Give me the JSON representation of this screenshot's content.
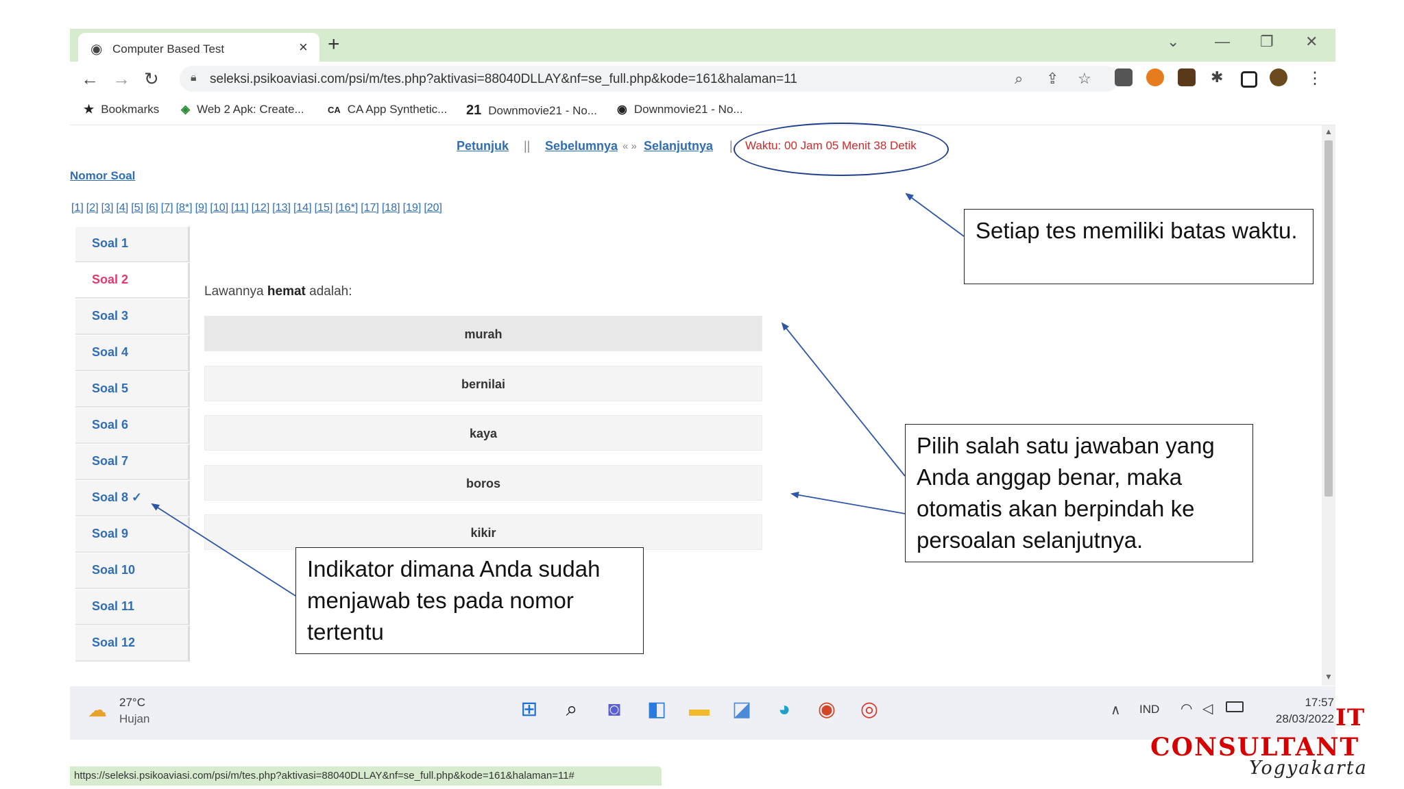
{
  "browser": {
    "tab_title": "Computer Based Test",
    "tab_close": "×",
    "new_tab": "+",
    "window_controls": {
      "tab_search": "⌄",
      "minimize": "—",
      "restore": "❐",
      "close": "✕"
    },
    "url": "seleksi.psikoaviasi.com/psi/m/tes.php?aktivasi=88040DLLAY&nf=se_full.php&kode=161&halaman=11",
    "bookmarks": [
      {
        "icon": "star-icon",
        "label": "Bookmarks"
      },
      {
        "icon": "web2apk-icon",
        "label": "Web 2 Apk: Create..."
      },
      {
        "icon": "ca-icon",
        "label": "CA App Synthetic..."
      },
      {
        "icon": "21-icon",
        "label": "Downmovie21 - No..."
      },
      {
        "icon": "globe-icon",
        "label": "Downmovie21 - No..."
      }
    ],
    "status_url": "https://seleksi.psikoaviasi.com/psi/m/tes.php?aktivasi=88040DLLAY&nf=se_full.php&kode=161&halaman=11#"
  },
  "test": {
    "nav": {
      "petunjuk": "Petunjuk",
      "sep": "||",
      "sebelumnya": "Sebelumnya",
      "arrows": "« »",
      "selanjutnya": "Selanjutnya",
      "sep2": "|",
      "timer": "Waktu: 00 Jam 05 Menit 38 Detik"
    },
    "nomor_soal_label": "Nomor Soal",
    "numbers": [
      "[1]",
      "[2]",
      "[3]",
      "[4]",
      "[5]",
      "[6]",
      "[7]",
      "[8*]",
      "[9]",
      "[10]",
      "[11]",
      "[12]",
      "[13]",
      "[14]",
      "[15]",
      "[16*]",
      "[17]",
      "[18]",
      "[19]",
      "[20]"
    ],
    "sidebar": [
      {
        "label": "Soal 1"
      },
      {
        "label": "Soal 2",
        "active": true
      },
      {
        "label": "Soal 3"
      },
      {
        "label": "Soal 4"
      },
      {
        "label": "Soal 5"
      },
      {
        "label": "Soal 6"
      },
      {
        "label": "Soal 7"
      },
      {
        "label": "Soal 8 ✓"
      },
      {
        "label": "Soal 9"
      },
      {
        "label": "Soal 10"
      },
      {
        "label": "Soal 11"
      },
      {
        "label": "Soal 12"
      }
    ],
    "question_pre": "Lawannya",
    "question_bold": "hemat",
    "question_post": "adalah:",
    "options": [
      "murah",
      "bernilai",
      "kaya",
      "boros",
      "kikir"
    ]
  },
  "taskbar": {
    "temp": "27°C",
    "condition": "Hujan",
    "lang": "IND",
    "time": "17:57",
    "date": "28/03/2022"
  },
  "annotations": {
    "time_limit": "Setiap tes memiliki batas waktu.",
    "answer_hint": "Pilih salah satu jawaban yang Anda anggap benar, maka otomatis akan berpindah ke persoalan selanjutnya.",
    "indicator_hint": "Indikator dimana Anda sudah menjawab tes pada nomor tertentu",
    "arrow_color": "#2d55a8"
  },
  "logo": {
    "line1": "IT",
    "line2": "CONSULTANT",
    "line3": "Yogyakarta",
    "color": "#d60000"
  }
}
